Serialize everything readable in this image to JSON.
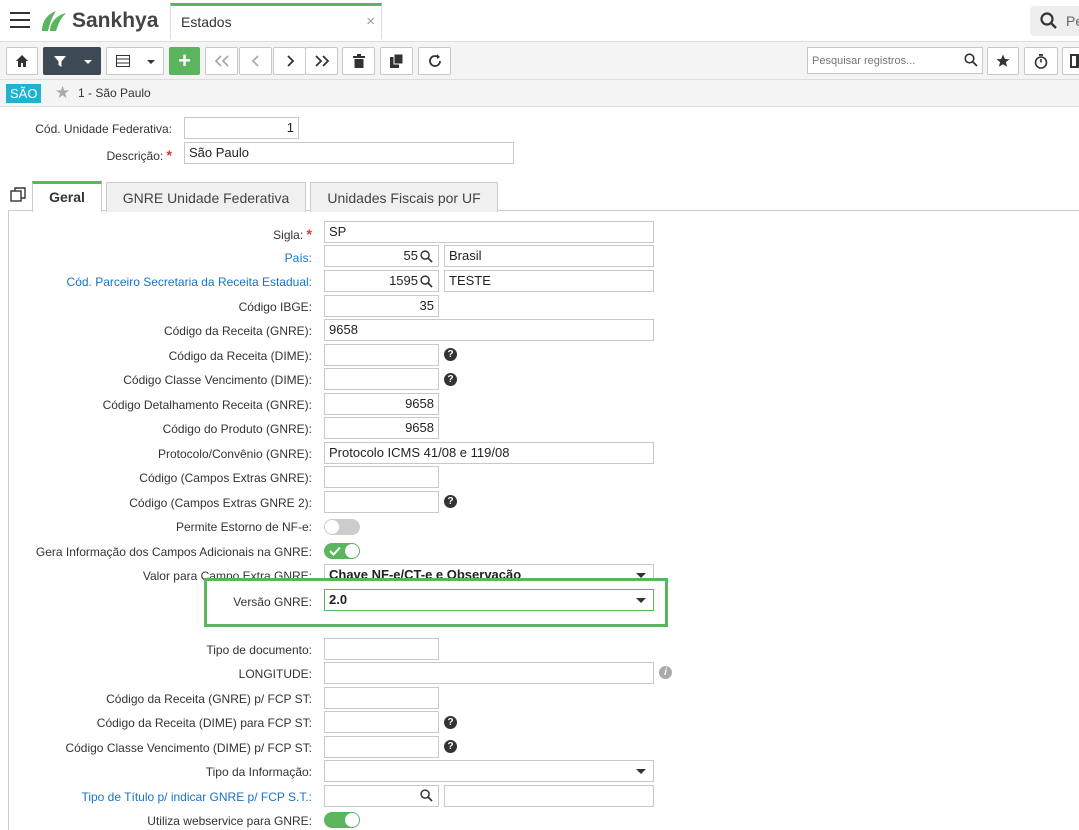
{
  "app": {
    "brand": "Sankhya",
    "tab_title": "Estados",
    "tab_close": "×",
    "top_search_text": "Pe"
  },
  "toolbar": {
    "search_placeholder": "Pesquisar registros..."
  },
  "breadcrumb": {
    "badge": "SÃO",
    "text": "1 - São Paulo"
  },
  "header_fields": {
    "cod_label": "Cód. Unidade Federativa:",
    "cod_value": "1",
    "desc_label": "Descrição:",
    "desc_req": "*",
    "desc_value": "São Paulo"
  },
  "tabs": [
    "Geral",
    "GNRE Unidade Federativa",
    "Unidades Fiscais por UF"
  ],
  "fields": {
    "sigla": {
      "label": "Sigla:",
      "req": "*",
      "value": "SP"
    },
    "pais": {
      "label": "País:",
      "code": "55",
      "name": "Brasil"
    },
    "parceiro": {
      "label": "Cód. Parceiro Secretaria da Receita Estadual:",
      "code": "1595",
      "name": "TESTE"
    },
    "ibge": {
      "label": "Código IBGE:",
      "value": "35"
    },
    "receita_gnre": {
      "label": "Código da Receita (GNRE):",
      "value": "9658"
    },
    "receita_dime": {
      "label": "Código da Receita (DIME):",
      "value": ""
    },
    "classe_venc": {
      "label": "Código Classe Vencimento (DIME):",
      "value": ""
    },
    "detalhamento": {
      "label": "Código Detalhamento Receita (GNRE):",
      "value": "9658"
    },
    "produto": {
      "label": "Código do Produto (GNRE):",
      "value": "9658"
    },
    "protocolo": {
      "label": "Protocolo/Convênio (GNRE):",
      "value": "Protocolo ICMS 41/08 e 119/08"
    },
    "campos_extras": {
      "label": "Código (Campos Extras GNRE):",
      "value": ""
    },
    "campos_extras2": {
      "label": "Código (Campos Extras GNRE 2):",
      "value": ""
    },
    "estorno": {
      "label": "Permite Estorno de NF-e:",
      "on": false
    },
    "gera_info": {
      "label": "Gera Informação dos Campos Adicionais na GNRE:",
      "on": true
    },
    "valor_extra": {
      "label": "Valor para Campo Extra GNRE:",
      "value": "Chave NF-e/CT-e e Observação"
    },
    "versao": {
      "label": "Versão GNRE:",
      "value": "2.0"
    },
    "tipo_doc": {
      "label": "Tipo de documento:",
      "value": ""
    },
    "longitude": {
      "label": "LONGITUDE:",
      "value": ""
    },
    "fcp_gnre": {
      "label": "Código da Receita (GNRE) p/ FCP ST:",
      "value": ""
    },
    "fcp_dime": {
      "label": "Código da Receita (DIME) para FCP ST:",
      "value": ""
    },
    "fcp_classe": {
      "label": "Código Classe Vencimento (DIME) p/ FCP ST:",
      "value": ""
    },
    "tipo_info": {
      "label": "Tipo da Informação:",
      "value": ""
    },
    "tipo_titulo": {
      "label": "Tipo de Título p/ indicar GNRE p/ FCP S.T.:",
      "value": ""
    },
    "webservice": {
      "label": "Utiliza webservice para GNRE:",
      "on": true
    }
  },
  "icons": {
    "help": "?",
    "info": "i"
  },
  "colors": {
    "accent": "#5ab55e",
    "badge": "#1fb3d1",
    "link": "#1a73c8",
    "toolbar_dark": "#3d4a55"
  }
}
